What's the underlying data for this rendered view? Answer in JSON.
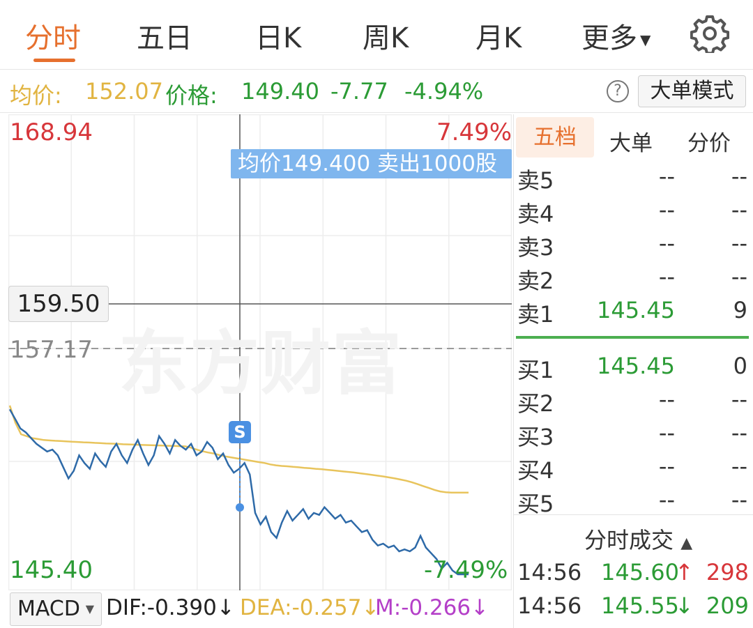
{
  "tabs": [
    {
      "label": "分时",
      "active": true
    },
    {
      "label": "五日",
      "active": false
    },
    {
      "label": "日K",
      "active": false
    },
    {
      "label": "周K",
      "active": false
    },
    {
      "label": "月K",
      "active": false
    },
    {
      "label": "更多",
      "active": false
    }
  ],
  "icons": {
    "settings": "gear-icon",
    "help": "question-circle-icon",
    "more_caret": "caret-down-icon",
    "trade_up": "arrow-up-icon",
    "trade_down": "arrow-down-icon"
  },
  "info": {
    "avg_label": "均价:",
    "avg_value": "152.07",
    "price_label": "价格:",
    "price_value": "149.40",
    "change": "-7.77",
    "change_pct": "-4.94%",
    "help_glyph": "?",
    "mode_button": "大单模式"
  },
  "chart": {
    "y_max": "168.94",
    "y_max_pct": "7.49%",
    "y_min": "145.40",
    "y_min_pct": "-7.49%",
    "prev_close": "157.17",
    "crosshair_price": "159.50",
    "tooltip": "均价149.400  卖出1000股",
    "signal": "S",
    "watermark": "东方财富"
  },
  "chart_data": {
    "type": "line",
    "ylim": [
      145.4,
      168.94
    ],
    "reference_line": 157.17,
    "series": [
      {
        "key": "price",
        "color": "#2e6aa8",
        "values": [
          154.0,
          153.5,
          153.0,
          152.8,
          152.5,
          152.2,
          152.0,
          151.8,
          151.9,
          151.6,
          151.0,
          150.4,
          150.8,
          151.6,
          151.2,
          150.9,
          151.7,
          151.3,
          151.0,
          151.8,
          152.2,
          151.6,
          151.2,
          151.9,
          152.4,
          151.7,
          151.1,
          151.6,
          152.6,
          152.2,
          151.7,
          152.4,
          152.1,
          151.9,
          152.2,
          151.6,
          151.8,
          152.3,
          152.0,
          151.4,
          151.7,
          151.1,
          150.7,
          150.9,
          151.2,
          150.6,
          148.6,
          148.0,
          148.4,
          147.6,
          147.3,
          148.1,
          148.7,
          148.2,
          148.5,
          148.8,
          148.3,
          148.6,
          148.5,
          148.9,
          148.6,
          148.3,
          148.5,
          148.1,
          148.2,
          147.9,
          147.6,
          147.7,
          147.2,
          146.9,
          147.0,
          146.8,
          146.9,
          146.6,
          146.7,
          146.6,
          146.8,
          147.4,
          146.8,
          146.5,
          146.2,
          145.7,
          146.0,
          145.6,
          145.4,
          145.4,
          145.4
        ]
      },
      {
        "key": "average",
        "color": "#e8c45c",
        "values": [
          154.2,
          153.3,
          152.7,
          152.6,
          152.5,
          152.45,
          152.4,
          152.38,
          152.36,
          152.35,
          152.33,
          152.31,
          152.3,
          152.28,
          152.27,
          152.25,
          152.24,
          152.22,
          152.21,
          152.2,
          152.18,
          152.17,
          152.16,
          152.15,
          152.14,
          152.13,
          152.12,
          152.11,
          152.1,
          152.09,
          152.08,
          152.07,
          152.0,
          151.9,
          151.82,
          151.75,
          151.7,
          151.62,
          151.55,
          151.5,
          151.45,
          151.4,
          151.35,
          151.3,
          151.25,
          151.2,
          151.13,
          151.08,
          151.05,
          151.03,
          151.0,
          150.98,
          150.95,
          150.93,
          150.9,
          150.88,
          150.85,
          150.82,
          150.79,
          150.76,
          150.73,
          150.7,
          150.66,
          150.62,
          150.58,
          150.54,
          150.5,
          150.45,
          150.4,
          150.34,
          150.28,
          150.2,
          150.1,
          150.0,
          149.9,
          149.8,
          149.72,
          149.68,
          149.66,
          149.66,
          149.66,
          149.66
        ]
      }
    ]
  },
  "indicators": {
    "selector": "MACD",
    "dif": "DIF:-0.390",
    "dea": "DEA:-0.257",
    "m": "M:-0.266",
    "arrow": "↓"
  },
  "panel": {
    "tabs": [
      "五档",
      "大单",
      "分价"
    ],
    "sells": [
      {
        "label": "卖5",
        "price": "--",
        "vol": "--"
      },
      {
        "label": "卖4",
        "price": "--",
        "vol": "--"
      },
      {
        "label": "卖3",
        "price": "--",
        "vol": "--"
      },
      {
        "label": "卖2",
        "price": "--",
        "vol": "--"
      },
      {
        "label": "卖1",
        "price": "145.45",
        "vol": "9"
      }
    ],
    "buys": [
      {
        "label": "买1",
        "price": "145.45",
        "vol": "0"
      },
      {
        "label": "买2",
        "price": "--",
        "vol": "--"
      },
      {
        "label": "买3",
        "price": "--",
        "vol": "--"
      },
      {
        "label": "买4",
        "price": "--",
        "vol": "--"
      },
      {
        "label": "买5",
        "price": "--",
        "vol": "--"
      }
    ],
    "trades_title": "分时成交",
    "trades_caret": "▲",
    "trades": [
      {
        "time": "14:56",
        "price": "145.60",
        "dir": "↑",
        "vol": "298"
      },
      {
        "time": "14:56",
        "price": "145.55",
        "dir": "↓",
        "vol": "209"
      }
    ]
  }
}
